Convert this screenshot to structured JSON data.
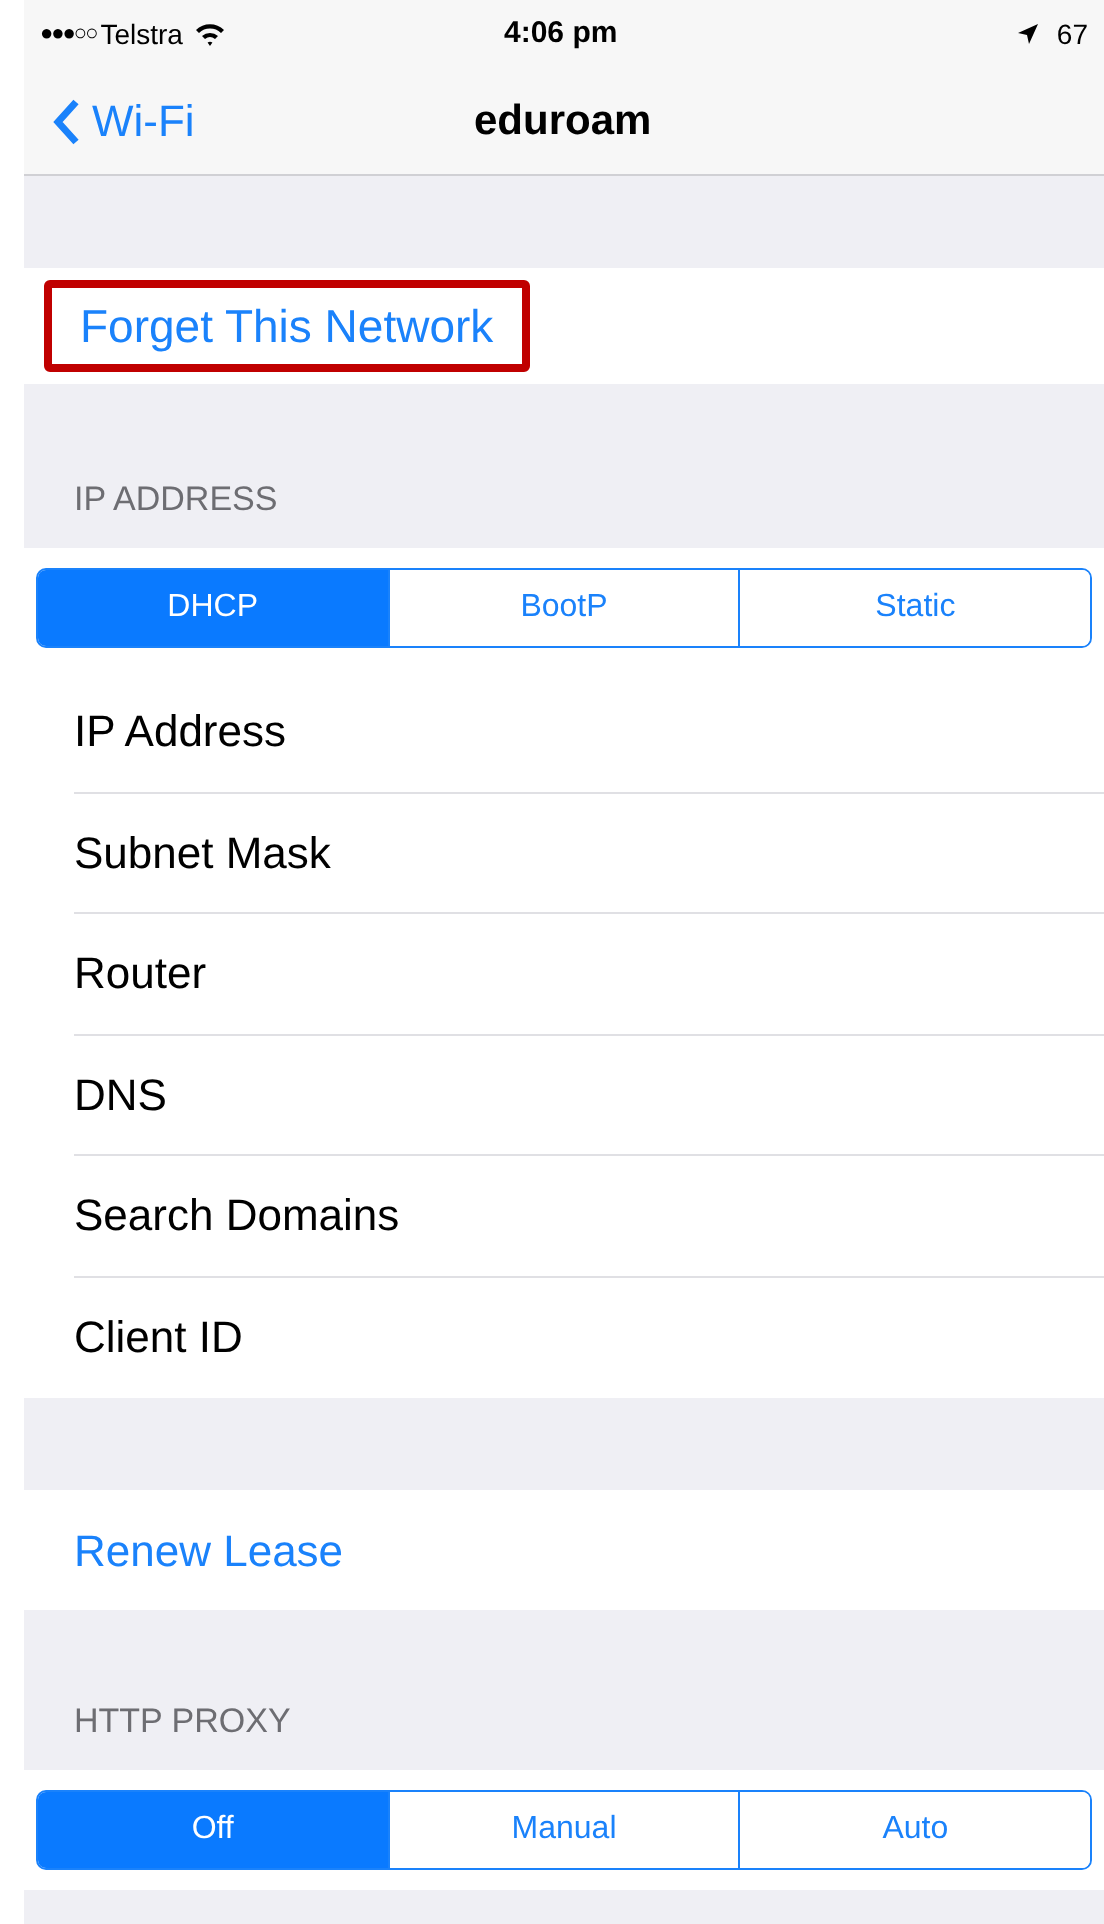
{
  "status_bar": {
    "carrier": "Telstra",
    "signal_dots": "●●●○○",
    "time": "4:06 pm",
    "battery": "67"
  },
  "nav": {
    "back": "Wi-Fi",
    "title": "eduroam"
  },
  "forget": {
    "label": "Forget This Network",
    "highlighted": true
  },
  "ip_section": {
    "header": "IP ADDRESS",
    "segments": [
      {
        "label": "DHCP",
        "selected": true
      },
      {
        "label": "BootP",
        "selected": false
      },
      {
        "label": "Static",
        "selected": false
      }
    ],
    "rows": [
      "IP Address",
      "Subnet Mask",
      "Router",
      "DNS",
      "Search Domains",
      "Client ID"
    ]
  },
  "renew": {
    "label": "Renew Lease"
  },
  "proxy_section": {
    "header": "HTTP PROXY",
    "segments": [
      {
        "label": "Off",
        "selected": true
      },
      {
        "label": "Manual",
        "selected": false
      },
      {
        "label": "Auto",
        "selected": false
      }
    ]
  }
}
